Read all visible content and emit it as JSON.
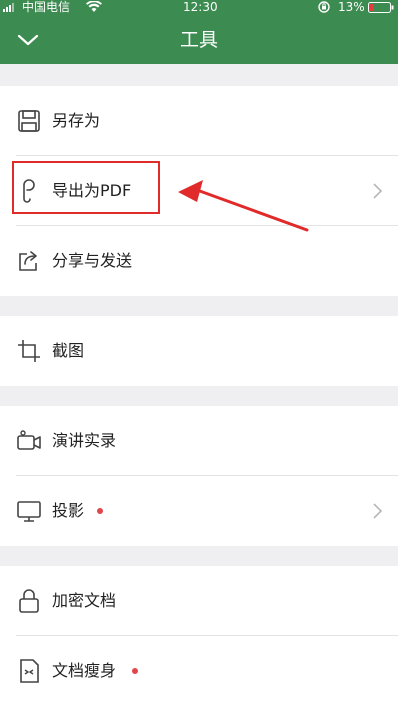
{
  "status_bar": {
    "carrier": "中国电信",
    "time": "12:30",
    "battery": "13%"
  },
  "nav": {
    "title": "工具"
  },
  "menu": {
    "save_as": "另存为",
    "export_pdf": "导出为PDF",
    "share_send": "分享与发送",
    "screenshot": "截图",
    "presentation_record": "演讲实录",
    "projection": "投影",
    "encrypt_document": "加密文档",
    "slim_document": "文档瘦身"
  },
  "colors": {
    "header": "#3c8b50",
    "annotation": "#e12a2a",
    "badge_dot": "#e2454a"
  }
}
